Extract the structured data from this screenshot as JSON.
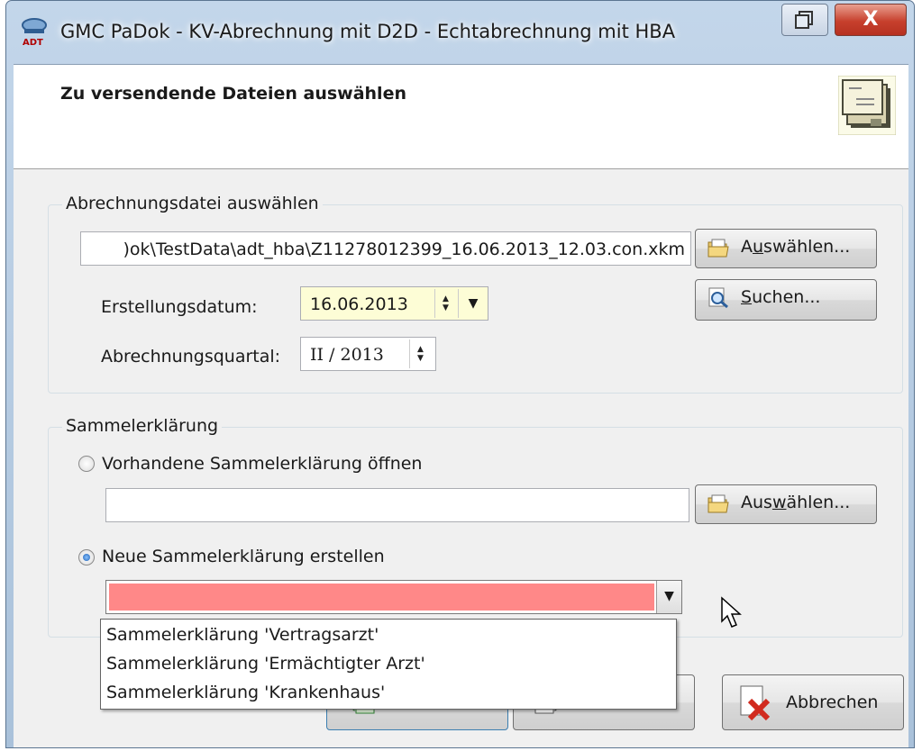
{
  "window": {
    "title": "GMC PaDok  -  KV-Abrechnung mit D2D  -  Echtabrechnung mit HBA",
    "app_icon": "adt-app-icon",
    "close_glyph": "X"
  },
  "header": {
    "title": "Zu versendende Dateien auswählen",
    "icon": "envelope-stack-icon"
  },
  "abrechnung": {
    "group_label": "Abrechnungsdatei auswählen",
    "file_path": ")ok\\TestData\\adt_hba\\Z11278012399_16.06.2013_12.03.con.xkm",
    "select_button": "Auswählen...",
    "select_button_mnemonic": "u",
    "search_button": "Suchen...",
    "search_button_mnemonic": "S",
    "date_label": "Erstellungsdatum:",
    "date_value": "16.06.2013",
    "quarter_label": "Abrechnungsquartal:",
    "quarter_value": "II / 2013"
  },
  "sammel": {
    "group_label": "Sammelerklärung",
    "open_label": "Vorhandene Sammelerklärung öffnen",
    "open_selected": false,
    "open_path": "",
    "select_button": "Auswählen...",
    "select_button_mnemonic": "w",
    "new_label": "Neue Sammelerklärung erstellen",
    "new_selected": true,
    "combo_value": "",
    "combo_color": "#ff8888",
    "options": [
      "Sammelerklärung 'Vertragsarzt'",
      "Sammelerklärung 'Ermächtigter Arzt'",
      "Sammelerklärung 'Krankenhaus'"
    ]
  },
  "footer": {
    "cancel_button": "Abbrechen"
  }
}
